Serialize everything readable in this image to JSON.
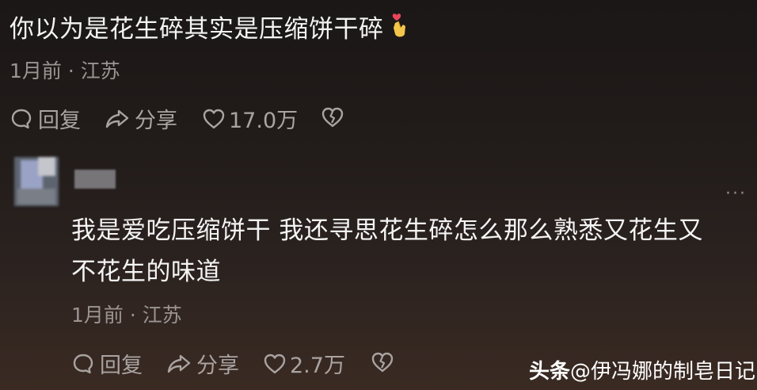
{
  "comment1": {
    "text": "你以为是花生碎其实是压缩饼干碎",
    "emoji": "hand-heart-icon",
    "time": "1月前",
    "separator": "·",
    "location": "江苏",
    "reply_label": "回复",
    "share_label": "分享",
    "like_count": "17.0万"
  },
  "comment2": {
    "text_line1": "我是爱吃压缩饼干 我还寻思花生碎怎么那么熟悉又花生又",
    "text_line2": "不花生的味道",
    "time": "1月前",
    "separator": "·",
    "location": "江苏",
    "reply_label": "回复",
    "share_label": "分享",
    "like_count": "2.7万",
    "more": "···"
  },
  "watermark": {
    "brand": "头条",
    "handle": "@伊冯娜的制皂日记"
  },
  "colors": {
    "text": "#f4f4f4",
    "meta": "#9b9492",
    "action": "#a9a3a1",
    "emoji_heart": "#e8455a",
    "emoji_hand": "#f3c64a"
  }
}
